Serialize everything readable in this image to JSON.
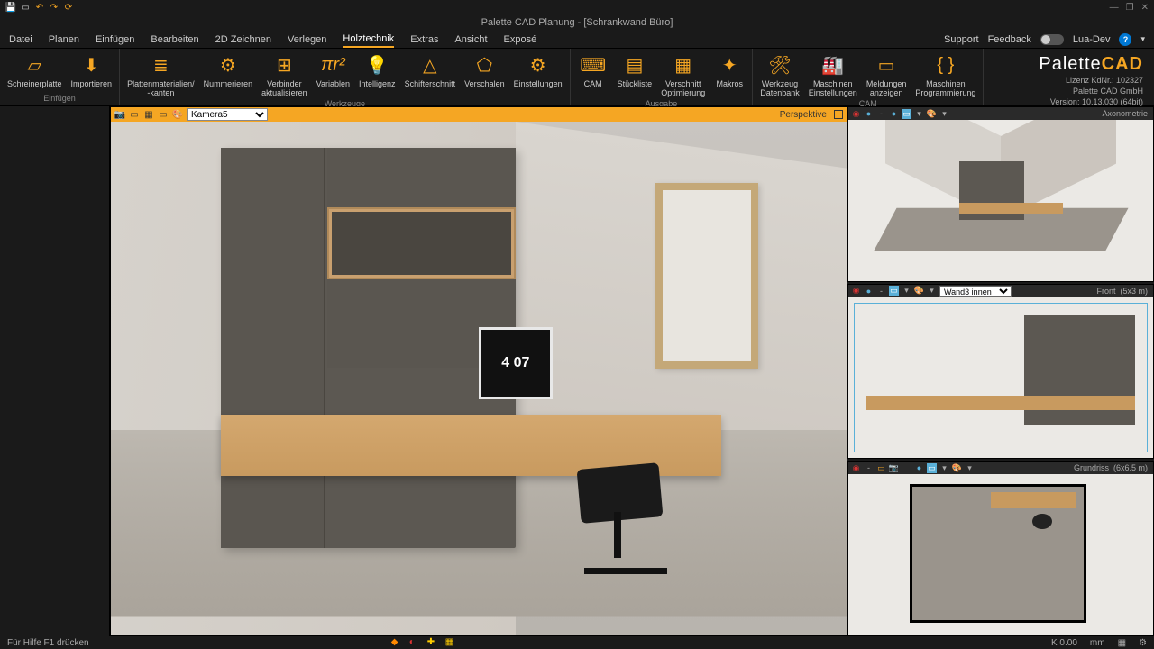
{
  "app": {
    "title": "Palette CAD Planung - [Schrankwand Büro]"
  },
  "qat_icons": [
    "save-icon",
    "new-icon",
    "undo-icon",
    "redo-icon",
    "refresh-icon"
  ],
  "window_controls": {
    "min": "—",
    "max": "❐",
    "close": "✕"
  },
  "menu": {
    "items": [
      "Datei",
      "Planen",
      "Einfügen",
      "Bearbeiten",
      "2D Zeichnen",
      "Verlegen",
      "Holztechnik",
      "Extras",
      "Ansicht",
      "Exposé"
    ],
    "active": "Holztechnik",
    "right": {
      "support": "Support",
      "feedback": "Feedback",
      "luadev": "Lua-Dev",
      "help": "?"
    }
  },
  "ribbon": {
    "groups": [
      {
        "label": "Einfügen",
        "items": [
          {
            "name": "schreinerplatte",
            "label": "Schreinerplatte",
            "icon": "board"
          },
          {
            "name": "importieren",
            "label": "Importieren",
            "icon": "import"
          }
        ]
      },
      {
        "label": "Werkzeuge",
        "items": [
          {
            "name": "plattenmaterialien",
            "label": "Plattenmaterialien/\n-kanten",
            "icon": "layers"
          },
          {
            "name": "nummerieren",
            "label": "Nummerieren",
            "icon": "number"
          },
          {
            "name": "verbinder",
            "label": "Verbinder\naktualisieren",
            "icon": "connector"
          },
          {
            "name": "variablen",
            "label": "Variablen",
            "icon": "formula"
          },
          {
            "name": "intelligenz",
            "label": "Intelligenz",
            "icon": "bulb"
          },
          {
            "name": "schifterschnitt",
            "label": "Schifterschnitt",
            "icon": "angle"
          },
          {
            "name": "verschalen",
            "label": "Verschalen",
            "icon": "shape"
          },
          {
            "name": "einstellungen",
            "label": "Einstellungen",
            "icon": "gear"
          }
        ]
      },
      {
        "label": "Ausgabe",
        "items": [
          {
            "name": "cam",
            "label": "CAM",
            "icon": "cnc"
          },
          {
            "name": "stueckliste",
            "label": "Stückliste",
            "icon": "list"
          },
          {
            "name": "verschnitt",
            "label": "Verschnitt\nOptimierung",
            "icon": "optimize"
          },
          {
            "name": "makros",
            "label": "Makros",
            "icon": "macro"
          }
        ]
      },
      {
        "label": "CAM",
        "items": [
          {
            "name": "werkzeugdb",
            "label": "Werkzeug\nDatenbank",
            "icon": "tooldb"
          },
          {
            "name": "maschinen-einst",
            "label": "Maschinen\nEinstellungen",
            "icon": "machine"
          },
          {
            "name": "meldungen",
            "label": "Meldungen\nanzeigen",
            "icon": "msg"
          },
          {
            "name": "maschinen-prog",
            "label": "Maschinen\nProgrammierung",
            "icon": "prog"
          }
        ]
      }
    ]
  },
  "branding": {
    "logo_a": "Palette",
    "logo_b": "CAD",
    "license": "Lizenz KdNr.: 102327",
    "company": "Palette CAD GmbH",
    "version": "Version: 10.13.030 (64bit)"
  },
  "viewports": {
    "main": {
      "camera": "Kamera5",
      "label": "Perspektive",
      "monitor": "4 07"
    },
    "axo": {
      "label": "Axonometrie"
    },
    "front": {
      "layer": "Wand3 innen",
      "label": "Front",
      "dims": "(5x3 m)"
    },
    "plan": {
      "label": "Grundriss",
      "dims": "(6x6.5 m)"
    }
  },
  "statusbar": {
    "hint": "Für Hilfe F1 drücken",
    "coord": "K 0.00",
    "unit": "mm"
  }
}
